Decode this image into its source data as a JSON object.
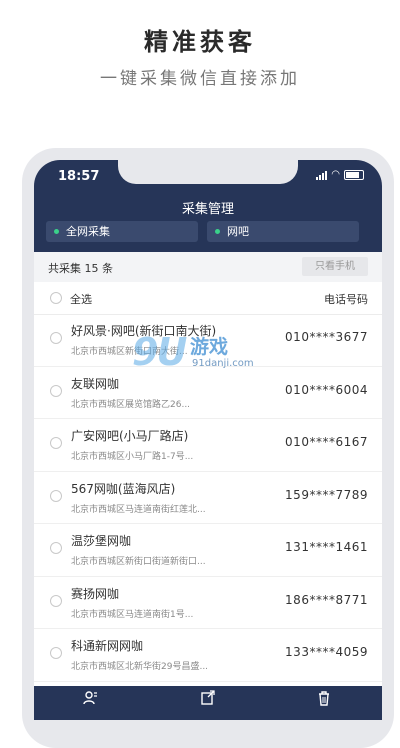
{
  "hero": {
    "title": "精准获客",
    "subtitle": "一键采集微信直接添加"
  },
  "status_bar": {
    "time": "18:57"
  },
  "nav": {
    "title": "采集管理"
  },
  "filters": [
    {
      "label": "全网采集",
      "dot_color": "#3ad18a"
    },
    {
      "label": "网吧",
      "dot_color": "#3ad18a"
    }
  ],
  "summary": {
    "count_text": "共采集 15 条",
    "phone_only_label": "只看手机"
  },
  "list_header": {
    "select_all": "全选",
    "phone_column": "电话号码"
  },
  "rows": [
    {
      "name": "好风景·网吧(新街口南大街)",
      "address": "北京市西城区新街口南大街...",
      "phone": "010****3677"
    },
    {
      "name": "友联网咖",
      "address": "北京市西城区展览馆路乙26...",
      "phone": "010****6004"
    },
    {
      "name": "广安网吧(小马厂路店)",
      "address": "北京市西城区小马厂路1-7号...",
      "phone": "010****6167"
    },
    {
      "name": "567网咖(蓝海风店)",
      "address": "北京市西城区马连道南街红莲北...",
      "phone": "159****7789"
    },
    {
      "name": "温莎堡网咖",
      "address": "北京市西城区新街口街道新街口...",
      "phone": "131****1461"
    },
    {
      "name": "赛扬网咖",
      "address": "北京市西城区马连道南街1号...",
      "phone": "186****8771"
    },
    {
      "name": "科通新网网咖",
      "address": "北京市西城区北新华街29号昌盛...",
      "phone": "133****4059"
    }
  ],
  "watermark": {
    "logo": "9U",
    "text": "游戏",
    "url": "91danji.com"
  },
  "colors": {
    "header": "#263558",
    "accent_dot": "#3ad18a"
  }
}
